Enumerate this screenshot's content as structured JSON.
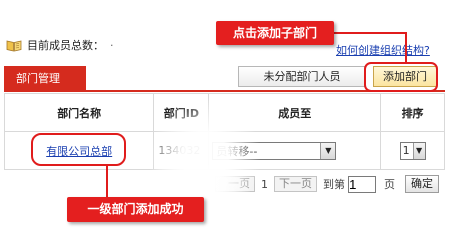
{
  "header": {
    "icon": "book-icon",
    "member_label": "目前成员总数：",
    "member_count": "·",
    "help_link": "如何创建组织结构?"
  },
  "tabs": {
    "active_label": "部门管理",
    "unassigned_button": "未分配部门人员",
    "add_button": "添加部门"
  },
  "table": {
    "columns": [
      "部门名称",
      "部门ID",
      "成员至",
      "排序"
    ],
    "rows": [
      {
        "name": "有限公司总部",
        "id": "134032",
        "move_select": "员转移--",
        "order": "1"
      }
    ]
  },
  "pager": {
    "prev_label": "一页",
    "page_number": "1",
    "next_label": "下一页",
    "goto_label": "到第",
    "goto_value": "1",
    "page_suffix": "页",
    "confirm_label": "确定"
  },
  "annotations": {
    "top_callout": "点击添加子部门",
    "bottom_callout": "一级部门添加成功"
  },
  "colors": {
    "accent_red": "#d52b1e",
    "callout_red": "#e41f1f",
    "link_blue": "#1a3fb0",
    "add_button_bg": "#fbe5a0"
  }
}
